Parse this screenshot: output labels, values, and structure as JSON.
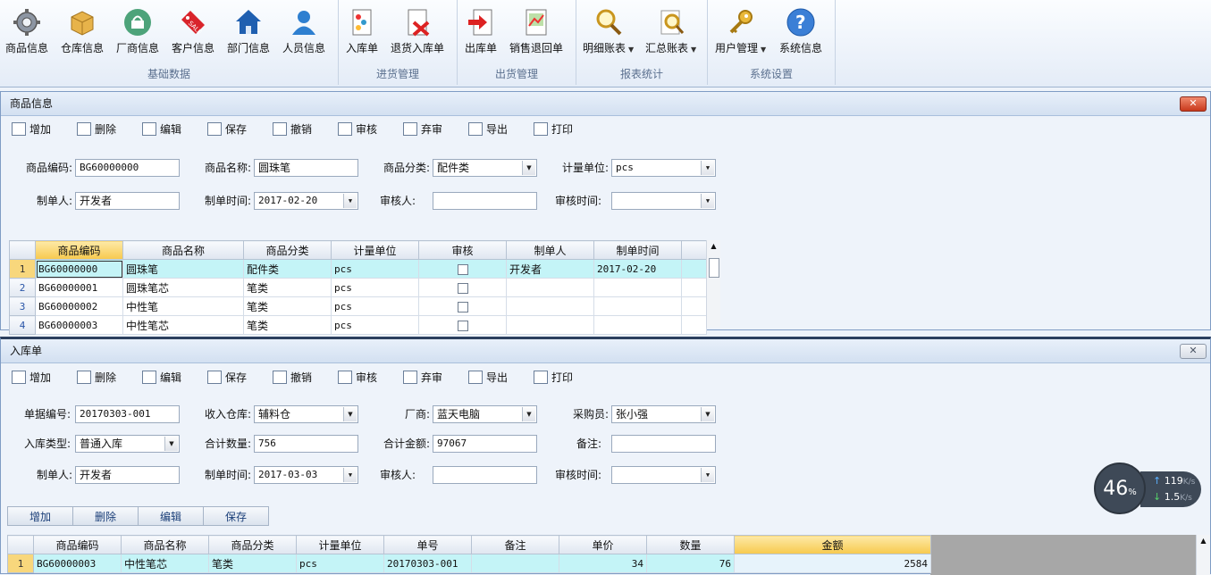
{
  "ribbon": {
    "groups": [
      {
        "label": "基础数据",
        "items": [
          "商品信息",
          "仓库信息",
          "厂商信息",
          "客户信息",
          "部门信息",
          "人员信息"
        ]
      },
      {
        "label": "进货管理",
        "items": [
          "入库单",
          "退货入库单"
        ]
      },
      {
        "label": "出货管理",
        "items": [
          "出库单",
          "销售退回单"
        ]
      },
      {
        "label": "报表统计",
        "items": [
          "明细账表",
          "汇总账表"
        ]
      },
      {
        "label": "系统设置",
        "items": [
          "用户管理",
          "系统信息"
        ]
      }
    ]
  },
  "toolbar": [
    "增加",
    "删除",
    "编辑",
    "保存",
    "撤销",
    "审核",
    "弃审",
    "导出",
    "打印"
  ],
  "product_panel": {
    "title": "商品信息",
    "close_label": "✕",
    "fields": {
      "code": {
        "label": "商品编码:",
        "value": "BG60000000"
      },
      "name": {
        "label": "商品名称:",
        "value": "圆珠笔"
      },
      "category": {
        "label": "商品分类:",
        "value": "配件类"
      },
      "unit": {
        "label": "计量单位:",
        "value": "pcs"
      },
      "creator": {
        "label": "制单人:",
        "value": "开发者"
      },
      "created": {
        "label": "制单时间:",
        "value": "2017-02-20"
      },
      "auditor": {
        "label": "审核人:",
        "value": ""
      },
      "audit_time": {
        "label": "审核时间:",
        "value": ""
      }
    },
    "grid": {
      "columns": [
        "商品编码",
        "商品名称",
        "商品分类",
        "计量单位",
        "审核",
        "制单人",
        "制单时间"
      ],
      "rows": [
        {
          "n": "1",
          "code": "BG60000000",
          "name": "圆珠笔",
          "cat": "配件类",
          "unit": "pcs",
          "creator": "开发者",
          "date": "2017-02-20"
        },
        {
          "n": "2",
          "code": "BG60000001",
          "name": "圆珠笔芯",
          "cat": "笔类",
          "unit": "pcs",
          "creator": "",
          "date": ""
        },
        {
          "n": "3",
          "code": "BG60000002",
          "name": "中性笔",
          "cat": "笔类",
          "unit": "pcs",
          "creator": "",
          "date": ""
        },
        {
          "n": "4",
          "code": "BG60000003",
          "name": "中性笔芯",
          "cat": "笔类",
          "unit": "pcs",
          "creator": "",
          "date": ""
        }
      ]
    }
  },
  "receipt_panel": {
    "title": "入库单",
    "close_label": "✕",
    "fields": {
      "doc_no": {
        "label": "单据编号:",
        "value": "20170303-001"
      },
      "warehouse": {
        "label": "收入仓库:",
        "value": "辅料仓"
      },
      "vendor": {
        "label": "厂商:",
        "value": "蓝天电脑"
      },
      "buyer": {
        "label": "采购员:",
        "value": "张小强"
      },
      "type": {
        "label": "入库类型:",
        "value": "普通入库"
      },
      "qty_total": {
        "label": "合计数量:",
        "value": "756"
      },
      "amount_total": {
        "label": "合计金额:",
        "value": "97067"
      },
      "remark": {
        "label": "备注:",
        "value": ""
      },
      "creator": {
        "label": "制单人:",
        "value": "开发者"
      },
      "created": {
        "label": "制单时间:",
        "value": "2017-03-03"
      },
      "auditor": {
        "label": "审核人:",
        "value": ""
      },
      "audit_time": {
        "label": "审核时间:",
        "value": ""
      }
    },
    "detail_buttons": [
      "增加",
      "删除",
      "编辑",
      "保存"
    ],
    "grid": {
      "columns": [
        "商品编码",
        "商品名称",
        "商品分类",
        "计量单位",
        "单号",
        "备注",
        "单价",
        "数量",
        "金额"
      ],
      "rows": [
        {
          "n": "1",
          "code": "BG60000003",
          "name": "中性笔芯",
          "cat": "笔类",
          "unit": "pcs",
          "no": "20170303-001",
          "remark": "",
          "price": "34",
          "qty": "76",
          "amount": "2584"
        }
      ]
    }
  },
  "net_widget": {
    "percent": "46",
    "percent_unit": "%",
    "up": "119",
    "down": "1.5",
    "unit": "K/s",
    "up_arrow": "↑",
    "down_arrow": "↓"
  }
}
